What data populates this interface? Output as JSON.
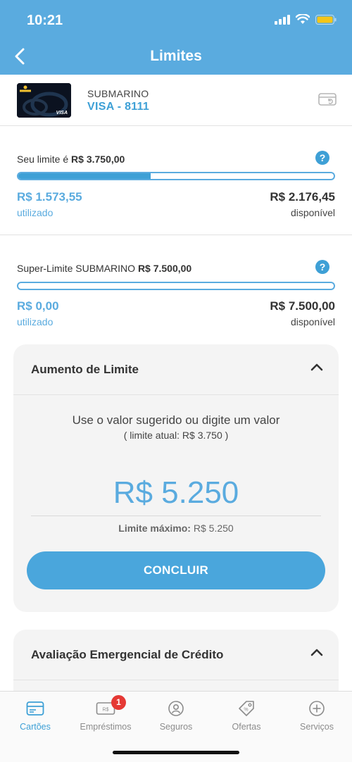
{
  "status": {
    "time": "10:21"
  },
  "nav": {
    "title": "Limites"
  },
  "card": {
    "name": "SUBMARINO",
    "number": "VISA - 8111",
    "thumb_brand": "Submarino",
    "thumb_network": "VISA"
  },
  "limit": {
    "label_prefix": "Seu limite é ",
    "label_value": "R$ 3.750,00",
    "used": "R$ 1.573,55",
    "used_label": "utilizado",
    "available": "R$ 2.176,45",
    "available_label": "disponível",
    "used_fraction": 0.42
  },
  "super_limit": {
    "label_prefix": "Super-Limite SUBMARINO ",
    "label_value": "R$ 7.500,00",
    "used": "R$ 0,00",
    "used_label": "utilizado",
    "available": "R$ 7.500,00",
    "available_label": "disponível",
    "used_fraction": 0
  },
  "increase": {
    "title": "Aumento de Limite",
    "instruction": "Use o valor sugerido ou digite um valor",
    "current": "( limite atual: R$ 3.750 )",
    "amount": "R$ 5.250",
    "max_label": "Limite máximo:",
    "max_value": " R$ 5.250",
    "button": "CONCLUIR"
  },
  "emergency": {
    "title": "Avaliação Emergencial de Crédito"
  },
  "tabs": [
    {
      "label": "Cartões",
      "icon": "cards-icon",
      "active": true
    },
    {
      "label": "Empréstimos",
      "icon": "loan-icon",
      "badge": "1"
    },
    {
      "label": "Seguros",
      "icon": "insurance-icon"
    },
    {
      "label": "Ofertas",
      "icon": "tag-icon"
    },
    {
      "label": "Serviços",
      "icon": "plus-circle-icon"
    }
  ],
  "colors": {
    "primary": "#5aabdf",
    "accent": "#3ea0d6",
    "badge": "#e53935",
    "panel_bg": "#f4f4f4"
  }
}
